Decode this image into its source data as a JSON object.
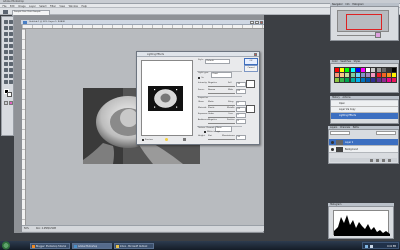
{
  "app": {
    "title": "Adobe Photoshop"
  },
  "menu": [
    "File",
    "Edit",
    "Image",
    "Layer",
    "Select",
    "Filter",
    "View",
    "Window",
    "Help"
  ],
  "options_bar": {
    "sample": "Sample Size: Point Sample",
    "dropdown": "Workspace ▾"
  },
  "document": {
    "title": "Untitled-1 @ 50% (Layer 1, RGB/8)",
    "zoom": "50%",
    "size": "Doc: 2.25M/4.50M"
  },
  "dialog": {
    "title": "Lighting Effects",
    "style_label": "Style:",
    "style_value": "Default",
    "ok": "OK",
    "cancel": "Cancel",
    "light_type_label": "Light type:",
    "light_type_value": "Omni",
    "on_label": "On",
    "intensity_label": "Intensity:",
    "intensity_left": "Negative",
    "intensity_right": "Full",
    "intensity_value": "35",
    "focus_label": "Focus:",
    "focus_left": "Narrow",
    "focus_right": "Wide",
    "focus_value": "69",
    "properties_label": "Properties",
    "gloss_label": "Gloss:",
    "gloss_left": "Matte",
    "gloss_right": "Shiny",
    "gloss_value": "0",
    "material_label": "Material:",
    "material_left": "Plastic",
    "material_right": "Metallic",
    "material_value": "69",
    "exposure_label": "Exposure:",
    "exposure_left": "Under",
    "exposure_right": "Over",
    "exposure_value": "0",
    "ambience_label": "Ambience:",
    "ambience_left": "Negative",
    "ambience_right": "Positive",
    "ambience_value": "8",
    "texture_label": "Texture Channel:",
    "texture_value": "None",
    "white_high_label": "White is high",
    "height_label": "Height:",
    "height_left": "Flat",
    "height_right": "Mountainous",
    "height_value": "50",
    "preview_label": "Preview"
  },
  "palettes": {
    "navigator_tabs": [
      "Navigator",
      "Info",
      "Histogram"
    ],
    "color_tabs": [
      "Color",
      "Swatches",
      "Styles"
    ],
    "history_tabs": [
      "History",
      "Actions"
    ],
    "layers_tabs": [
      "Layers",
      "Channels",
      "Paths"
    ],
    "history_items": [
      "Open",
      "Layer Via Copy",
      "Lighting Effects"
    ],
    "layers": [
      {
        "name": "Layer 1",
        "selected": true
      },
      {
        "name": "Background",
        "selected": false
      }
    ],
    "histogram_title": "Histogram"
  },
  "swatch_colors": [
    "#ff0000",
    "#ffff00",
    "#00ff00",
    "#00ffff",
    "#0000ff",
    "#ff00ff",
    "#ffffff",
    "#cccccc",
    "#999999",
    "#666666",
    "#333333",
    "#000000",
    "#f7977a",
    "#fdc68a",
    "#c4df9b",
    "#82ca9d",
    "#6ecff6",
    "#8493ca",
    "#a187be",
    "#f49ac2",
    "#ed1c24",
    "#f26522",
    "#f7941d",
    "#fff200",
    "#8dc63f",
    "#39b54a",
    "#00a651",
    "#00a99d",
    "#00aeef",
    "#0072bc",
    "#0054a6",
    "#2e3192",
    "#662d91",
    "#92278f",
    "#ec008c",
    "#ed145b"
  ],
  "taskbar": {
    "items": [
      "Blogger: Photoshop Tutorial",
      "Adobe Photoshop",
      "Inbox - Microsoft Outlook"
    ],
    "clock": "9:41 PM"
  }
}
